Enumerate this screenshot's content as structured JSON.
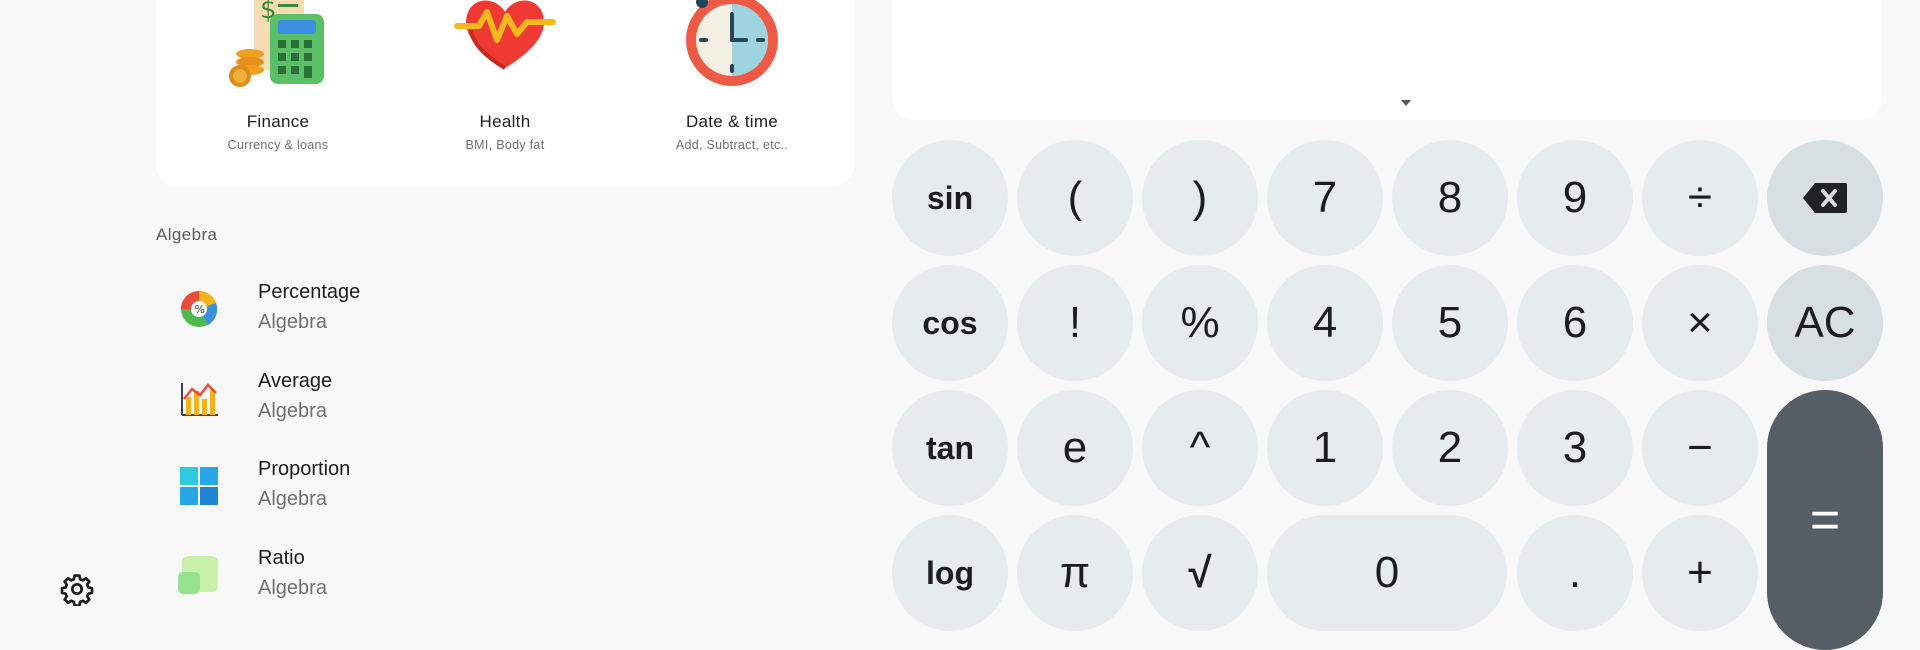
{
  "categories": [
    {
      "title": "Finance",
      "subtitle": "Currency & loans",
      "icon": "finance-icon"
    },
    {
      "title": "Health",
      "subtitle": "BMI, Body fat",
      "icon": "heart-icon"
    },
    {
      "title": "Date & time",
      "subtitle": "Add, Subtract, etc..",
      "icon": "clock-icon"
    }
  ],
  "section": {
    "label": "Algebra"
  },
  "tools": [
    {
      "name": "Percentage",
      "sub": "Algebra",
      "icon": "percentage-icon"
    },
    {
      "name": "Average",
      "sub": "Algebra",
      "icon": "average-chart-icon"
    },
    {
      "name": "Proportion",
      "sub": "Algebra",
      "icon": "proportion-grid-icon"
    },
    {
      "name": "Ratio",
      "sub": "Algebra",
      "icon": "ratio-squares-icon"
    }
  ],
  "keypad": {
    "sin": "sin",
    "lparen": "(",
    "rparen": ")",
    "k7": "7",
    "k8": "8",
    "k9": "9",
    "div": "÷",
    "cos": "cos",
    "fact": "!",
    "pct": "%",
    "k4": "4",
    "k5": "5",
    "k6": "6",
    "mul": "×",
    "ac": "AC",
    "tan": "tan",
    "e": "e",
    "pow": "^",
    "k1": "1",
    "k2": "2",
    "k3": "3",
    "minus": "−",
    "log": "log",
    "pi": "π",
    "sqrt": "√",
    "k0": "0",
    "dot": ".",
    "plus": "+",
    "equals": "="
  },
  "colors": {
    "background": "#f8f8f8",
    "key": "#e6ebee",
    "key_dark": "#d7dfe3",
    "equals": "#545e64"
  }
}
